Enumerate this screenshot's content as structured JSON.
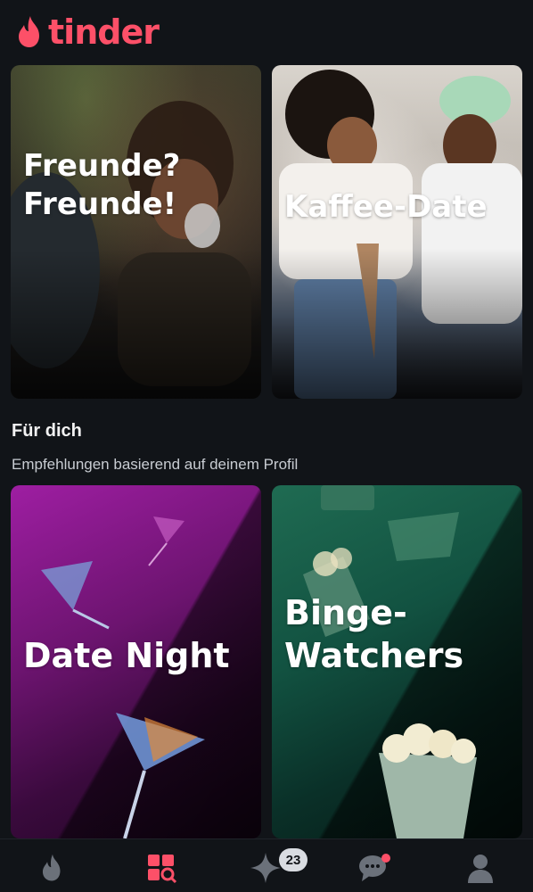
{
  "app": {
    "brand": "tinder",
    "brand_color": "#fd5068"
  },
  "featured": [
    {
      "title": "Freunde?\nFreunde!"
    },
    {
      "title": "Kaffee-Date"
    }
  ],
  "section": {
    "title": "Für dich",
    "subtitle": "Empfehlungen basierend auf deinem Profil"
  },
  "for_you": [
    {
      "title": "Date Night",
      "accent": "#9e1ea2"
    },
    {
      "title": "Binge-\nWatchers",
      "accent": "#1f6b52"
    }
  ],
  "tabbar": {
    "tabs": [
      {
        "icon": "flame-icon",
        "active": false
      },
      {
        "icon": "explore-icon",
        "active": true
      },
      {
        "icon": "sparkle-icon",
        "active": false,
        "badge": "23"
      },
      {
        "icon": "chat-icon",
        "active": false,
        "dot": true
      },
      {
        "icon": "profile-icon",
        "active": false
      }
    ],
    "active_color": "#fd5068",
    "inactive_color": "#6b717a"
  }
}
